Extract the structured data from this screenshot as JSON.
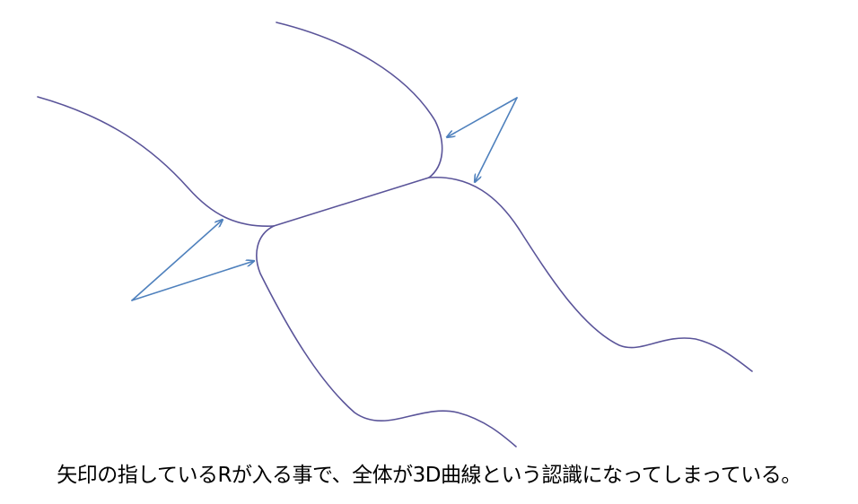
{
  "caption": "矢印の指しているRが入る事で、全体が3D曲線という認識になってしまっている。",
  "colors": {
    "curve": "#5a5499",
    "arrow": "#4f81bd",
    "text": "#000000",
    "background": "#ffffff"
  }
}
